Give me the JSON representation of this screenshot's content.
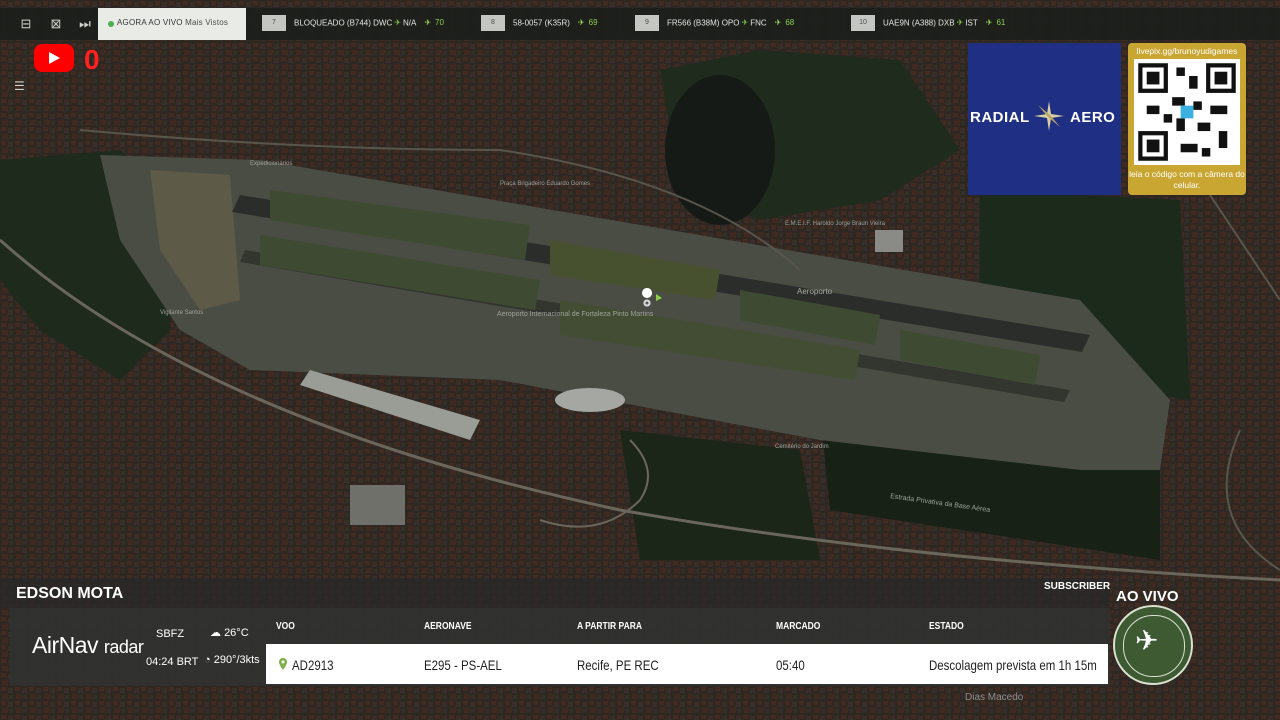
{
  "topbar": {
    "live_label": "AGORA AO VIVO",
    "live_sub": "Mais Vistos",
    "flights": [
      {
        "rank": "7",
        "flight": "BLOQUEADO (B744)",
        "from": "DWC",
        "to": "N/A",
        "count": "70"
      },
      {
        "rank": "8",
        "flight": "58-0057 (K35R)",
        "from": "",
        "to": "",
        "count": "69"
      },
      {
        "rank": "9",
        "flight": "FR566 (B38M)",
        "from": "OPO",
        "to": "FNC",
        "count": "68"
      },
      {
        "rank": "10",
        "flight": "UAE9N (A388)",
        "from": "DXB",
        "to": "IST",
        "count": "61"
      }
    ]
  },
  "youtube": {
    "count": "0"
  },
  "ads": {
    "radial": {
      "word1": "RADIAL",
      "word2": "AERO"
    },
    "qr": {
      "url": "livepix.gg/brunoyudigames",
      "caption": "leia o código com a câmera do celular."
    }
  },
  "map_labels": {
    "airport": "Aeroporto Internacional de Fortaleza Pinto Martins",
    "aeroporto": "Aeroporto",
    "bottom_road": "Estrada Privativa da Base Aérea",
    "dias_macedo": "Dias Macedo",
    "emeif": "E.M.E.I.F. Haroldo Jorge Braun Vieira",
    "praca": "Praça Brigadeiro Eduardo Gomes",
    "expedicionarios": "Expedicionários",
    "vigilante": "Vigilante Santos",
    "cemiterio": "Cemitério do Jardim"
  },
  "bottom": {
    "name": "EDSON MOTA",
    "subscriber": "SUBSCRIBER",
    "brand": "AirNav",
    "brand2": "radar",
    "icao": "SBFZ",
    "time": "04:24 BRT",
    "temp": "26°C",
    "wind": "290°/3kts",
    "headers": {
      "voo": "VOO",
      "aeronave": "AERONAVE",
      "partir": "A PARTIR PARA",
      "marcado": "MARCADO",
      "estado": "ESTADO"
    },
    "row": {
      "voo": "AD2913",
      "aeronave": "E295 - PS-AEL",
      "partir": "Recife, PE REC",
      "marcado": "05:40",
      "estado": "Descolagem prevista em 1h 15m"
    },
    "aovivo": "AO VIVO"
  }
}
